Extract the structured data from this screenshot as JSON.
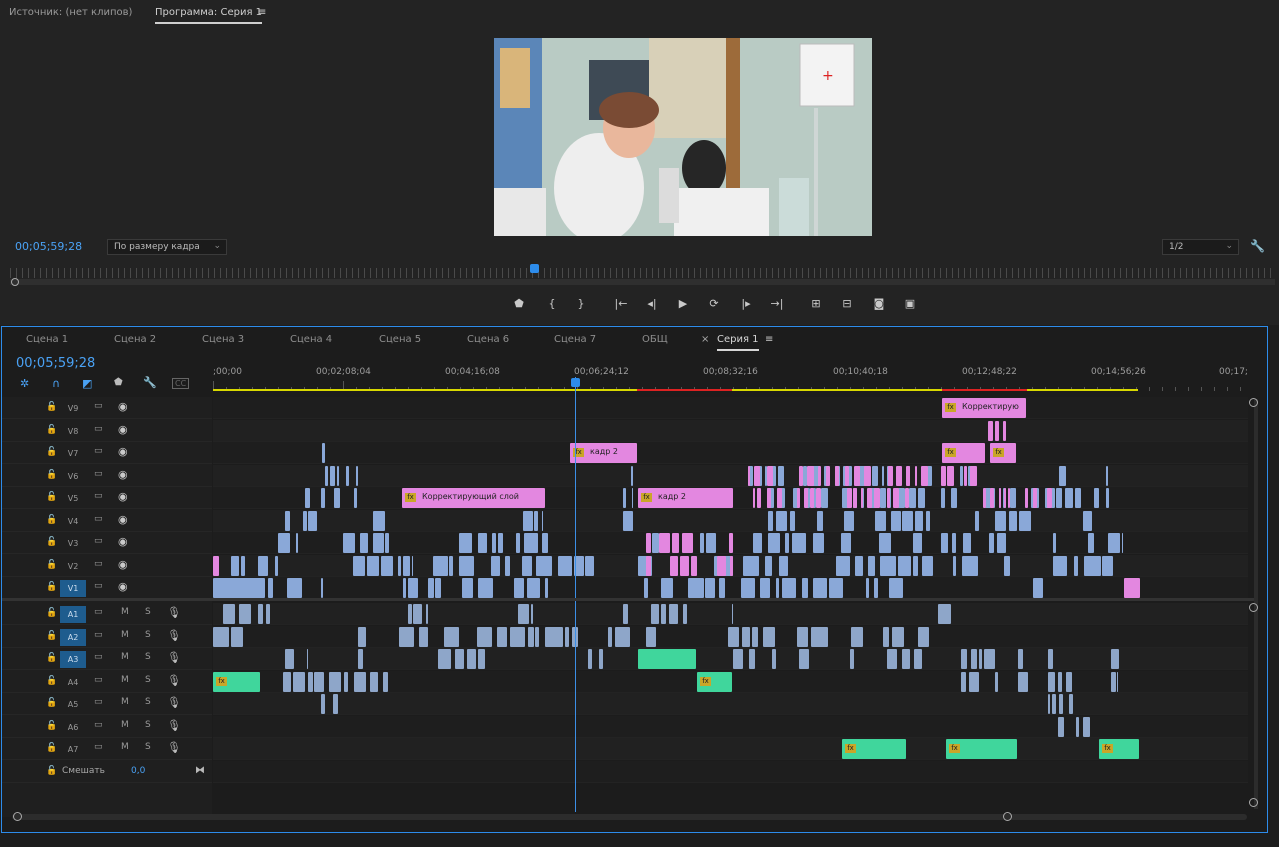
{
  "monitor": {
    "source_tab": "Источник: (нет клипов)",
    "program_tab": "Программа: Серия 1",
    "menu_icon": "hamburger-icon",
    "timecode": "00;05;59;28",
    "fit_dropdown": "По размеру кадра",
    "resolution_dropdown": "1/2",
    "controls": [
      "marker-icon",
      "mark-in-icon",
      "mark-out-icon",
      "go-to-in-icon",
      "step-back-icon",
      "play-icon",
      "loop-icon",
      "step-forward-icon",
      "go-to-out-icon",
      "lift-icon",
      "extract-icon",
      "camera-icon",
      "compare-icon"
    ]
  },
  "timeline": {
    "tabs": [
      "Сцена 1",
      "Сцена 2",
      "Сцена 3",
      "Сцена 4",
      "Сцена 5",
      "Сцена 6",
      "Сцена 7",
      "ОБЩ",
      "Серия 1"
    ],
    "active_tab": "Серия 1",
    "close_glyph": "×",
    "menu_glyph": "≡",
    "timecode": "00;05;59;28",
    "ruler_labels": [
      ";00;00",
      "00;02;08;04",
      "00;04;16;08",
      "00;06;24;12",
      "00;08;32;16",
      "00;10;40;18",
      "00;12;48;22",
      "00;14;56;26",
      "00;17;"
    ],
    "video_tracks": [
      "V9",
      "V8",
      "V7",
      "V6",
      "V5",
      "V4",
      "V3",
      "V2",
      "V1"
    ],
    "audio_tracks": [
      "A1",
      "A2",
      "A3",
      "A4",
      "A5",
      "A6",
      "A7"
    ],
    "mix_label": "Смешать",
    "mix_value": "0,0",
    "m_label": "M",
    "s_label": "S",
    "clip_labels": {
      "adjust_top": "Корректирую",
      "adjust_v5": "Корректирующий слой",
      "kadr_v7": "кадр 2",
      "kadr_v5": "кадр 2",
      "fx": "fx"
    }
  }
}
